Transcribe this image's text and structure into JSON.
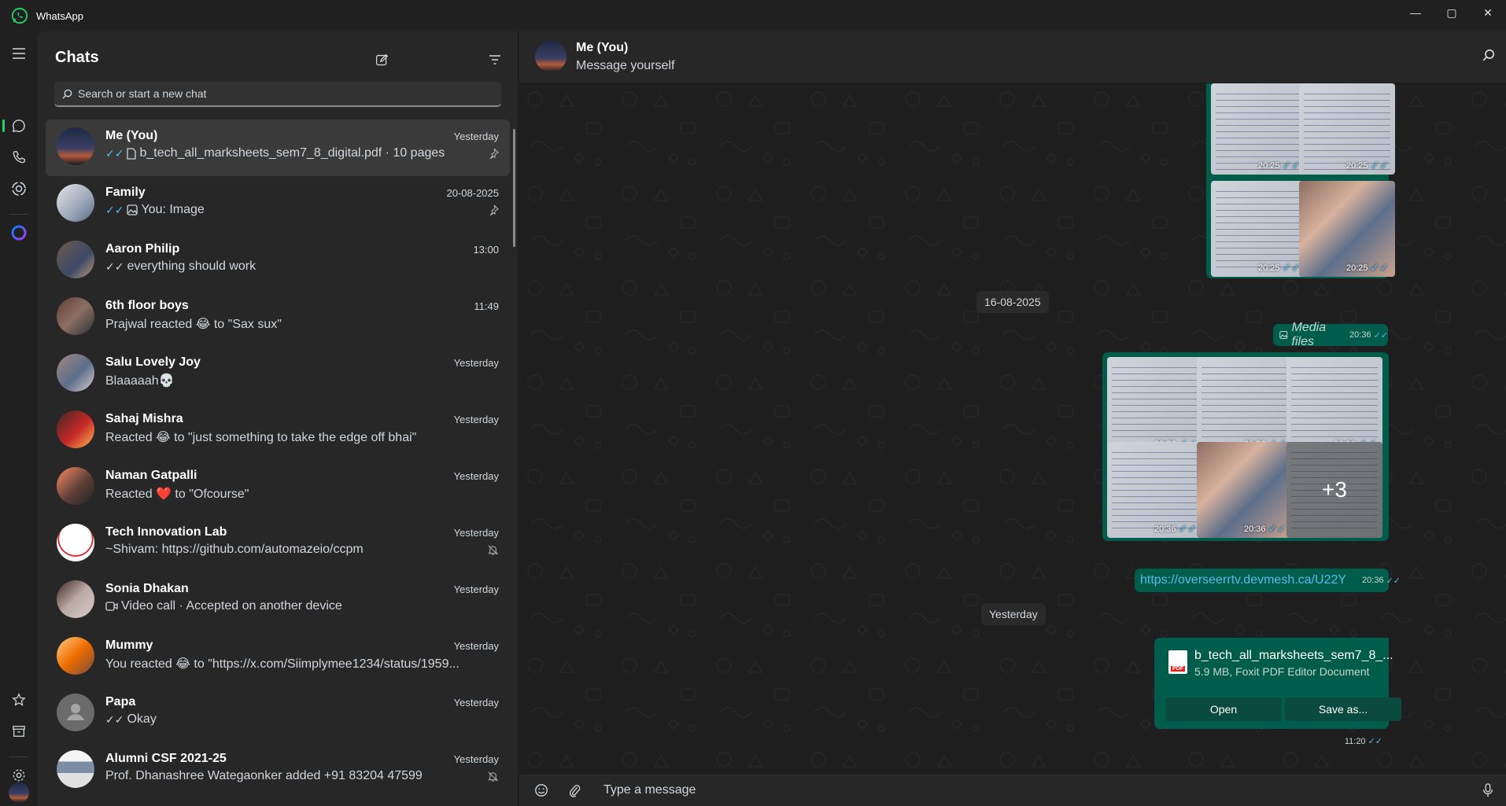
{
  "window": {
    "app_name": "WhatsApp",
    "controls": {
      "minimize": "—",
      "maximize": "▢",
      "close": "✕"
    }
  },
  "rail": {
    "items": [
      {
        "id": "menu",
        "icon": "hamburger-icon"
      },
      {
        "id": "chats",
        "icon": "chat-icon"
      },
      {
        "id": "calls",
        "icon": "phone-icon"
      },
      {
        "id": "status",
        "icon": "status-icon"
      },
      {
        "id": "meta-ai",
        "icon": "meta-ai-icon"
      },
      {
        "id": "starred",
        "icon": "star-icon"
      },
      {
        "id": "archived",
        "icon": "archive-icon"
      },
      {
        "id": "settings",
        "icon": "gear-icon"
      },
      {
        "id": "profile",
        "icon": "avatar"
      }
    ],
    "active": "chats",
    "accent": "#25d366"
  },
  "chatlist": {
    "title": "Chats",
    "search_placeholder": "Search or start a new chat",
    "chats": [
      {
        "name": "Me (You)",
        "time": "Yesterday",
        "preview": "b_tech_all_marksheets_sem7_8_digital.pdf · 10 pages",
        "tick": "read",
        "prefix_icon": "document-icon",
        "pinned": true,
        "selected": true
      },
      {
        "name": "Family",
        "time": "20-08-2025",
        "preview": "You:  Image",
        "tick": "read",
        "prefix_icon": "image-icon",
        "pinned": true
      },
      {
        "name": "Aaron Philip",
        "time": "13:00",
        "preview": "everything should work",
        "tick": "delivered"
      },
      {
        "name": "6th floor boys",
        "time": "11:49",
        "preview": "Prajwal reacted 😂 to \"Sax sux\""
      },
      {
        "name": "Salu Lovely Joy",
        "time": "Yesterday",
        "preview": "Blaaaaah💀"
      },
      {
        "name": "Sahaj Mishra",
        "time": "Yesterday",
        "preview": "Reacted 😂 to \"just something to take the edge off bhai\""
      },
      {
        "name": "Naman Gatpalli",
        "time": "Yesterday",
        "preview": "Reacted ❤️ to \"Ofcourse\""
      },
      {
        "name": "Tech Innovation Lab",
        "time": "Yesterday",
        "preview": "~Shivam: https://github.com/automazeio/ccpm",
        "muted": true
      },
      {
        "name": "Sonia Dhakan",
        "time": "Yesterday",
        "preview": "Video call · Accepted on another device",
        "prefix_icon": "video-icon"
      },
      {
        "name": "Mummy",
        "time": "Yesterday",
        "preview": "You reacted 😂 to \"https://x.com/Siimplymee1234/status/1959..."
      },
      {
        "name": "Papa",
        "time": "Yesterday",
        "preview": "Okay",
        "tick": "delivered"
      },
      {
        "name": "Alumni CSF 2021-25",
        "time": "Yesterday",
        "preview": "Prof. Dhanashree Wategaonker added +91 83204 47599",
        "muted": true
      }
    ]
  },
  "conversation": {
    "name": "Me (You)",
    "subtitle": "Message yourself",
    "group1_times": [
      "20:25",
      "20:25",
      "20:25",
      "20:25"
    ],
    "date_chip_1": "16-08-2025",
    "media_header": "Media files",
    "media_header_time": "20:36",
    "group2_times": [
      "20:36",
      "20:36",
      "20:36",
      "20:36",
      "20:36"
    ],
    "more_count": "+3",
    "link_text": "https://overseerrtv.devmesh.ca/U22Y",
    "link_time": "20:36",
    "date_chip_2": "Yesterday",
    "file": {
      "name": "b_tech_all_marksheets_sem7_8_...",
      "meta": "5.9 MB, Foxit PDF Editor Document",
      "open_label": "Open",
      "save_label": "Save as...",
      "time": "11:20",
      "badge": "PDF"
    },
    "composer_placeholder": "Type a message"
  },
  "colors": {
    "bubble": "#005c4b",
    "read_tick": "#53bdeb",
    "background": "#1e1e1e",
    "panel": "#272727"
  }
}
